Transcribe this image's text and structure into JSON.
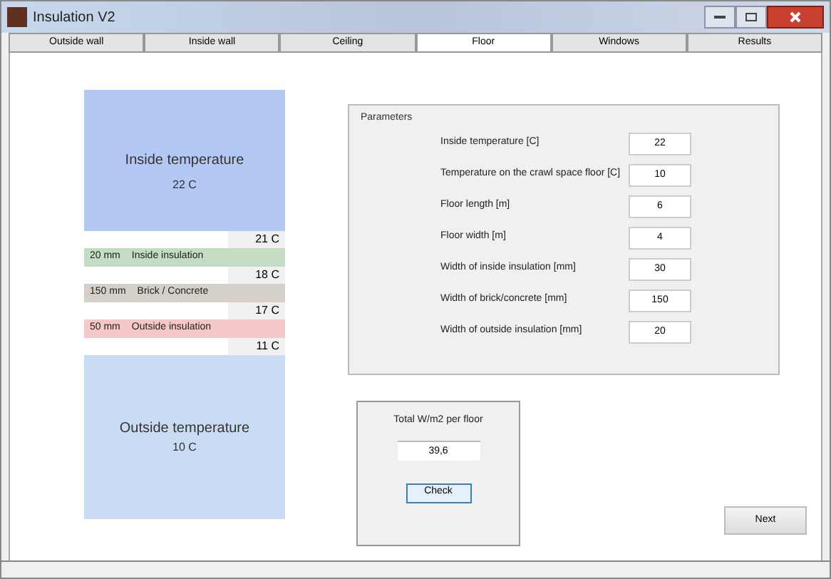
{
  "window": {
    "title": "Insulation V2"
  },
  "tabs": [
    {
      "label": "Outside wall",
      "selected": false
    },
    {
      "label": "Inside wall",
      "selected": false
    },
    {
      "label": "Ceiling",
      "selected": false
    },
    {
      "label": "Floor",
      "selected": true
    },
    {
      "label": "Windows",
      "selected": false
    },
    {
      "label": "Results",
      "selected": false
    }
  ],
  "diagram": {
    "inside": {
      "label": "Inside temperature",
      "value": "22 C"
    },
    "boundaries": [
      "21 C",
      "18 C",
      "17 C",
      "11 C"
    ],
    "layers": [
      {
        "width": "20 mm",
        "name": "Inside insulation",
        "color": "#c4dcc4"
      },
      {
        "width": "150 mm",
        "name": "Brick / Concrete",
        "color": "#d4d0c8"
      },
      {
        "width": "50 mm",
        "name": "Outside insulation",
        "color": "#f4c8c8"
      }
    ],
    "outside": {
      "label": "Outside temperature",
      "value": "10 C"
    }
  },
  "parameters": {
    "title": "Parameters",
    "fields": [
      {
        "label": "Inside temperature [C]",
        "value": "22"
      },
      {
        "label": "Temperature on the crawl space floor [C]",
        "value": "10"
      },
      {
        "label": "Floor length [m]",
        "value": "6"
      },
      {
        "label": "Floor width [m]",
        "value": "4"
      },
      {
        "label": "Width of inside insulation [mm]",
        "value": "30"
      },
      {
        "label": "Width of brick/concrete [mm]",
        "value": "150"
      },
      {
        "label": "Width of outside insulation [mm]",
        "value": "20"
      }
    ]
  },
  "result": {
    "label": "Total W/m2 per floor",
    "value": "39,6",
    "button": "Check"
  },
  "next_button": "Next"
}
